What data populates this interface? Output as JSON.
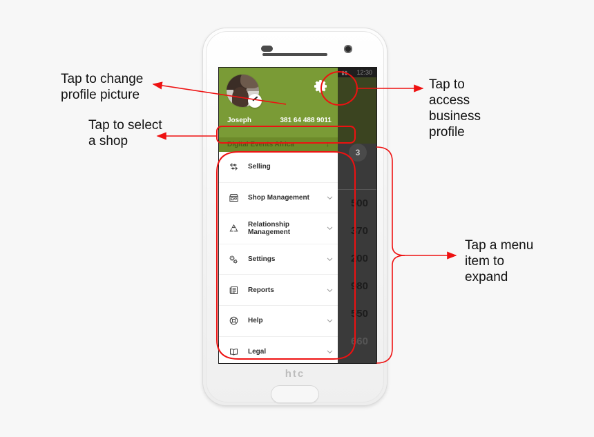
{
  "annotations": [
    {
      "id": "profile",
      "text": "Tap to change\nprofile picture"
    },
    {
      "id": "shop",
      "text": "Tap to select\na shop"
    },
    {
      "id": "business",
      "text": "Tap to\naccess\nbusiness\nprofile"
    },
    {
      "id": "menu",
      "text": "Tap a menu\nitem to\nexpand"
    }
  ],
  "annotation_color": "#ee1111",
  "device": {
    "brand_logo": "htc",
    "body_color": "#f4f4f4"
  },
  "screen": {
    "status_bar": {
      "time": "12:30",
      "signal_glyph": "▮▮"
    },
    "background_app": {
      "badge_count": "3",
      "search_icon": "search-icon",
      "amounts": [
        "500",
        "370",
        "200",
        "980",
        "550",
        "660"
      ]
    },
    "drawer": {
      "header_color": "#7a9b36",
      "shop_row_color": "#6d8a2a",
      "settings_gear_icon": "gear-icon",
      "avatar_edit_icon": "pencil-icon",
      "user_name": "Joseph",
      "user_phone": "381 64 488 9011",
      "shop_name": "Digital Events Africa",
      "shop_caret_glyph": "↓",
      "menu_items": [
        {
          "label": "Selling",
          "icon": "transfer-arrows-icon",
          "expandable": false
        },
        {
          "label": "Shop Management",
          "icon": "storefront-icon",
          "expandable": true
        },
        {
          "label": "Relationship Management",
          "icon": "recycle-nodes-icon",
          "expandable": true
        },
        {
          "label": "Settings",
          "icon": "gears-icon",
          "expandable": true
        },
        {
          "label": "Reports",
          "icon": "newspaper-icon",
          "expandable": true
        },
        {
          "label": "Help",
          "icon": "lifebuoy-icon",
          "expandable": true
        },
        {
          "label": "Legal",
          "icon": "open-book-icon",
          "expandable": true
        }
      ]
    }
  }
}
